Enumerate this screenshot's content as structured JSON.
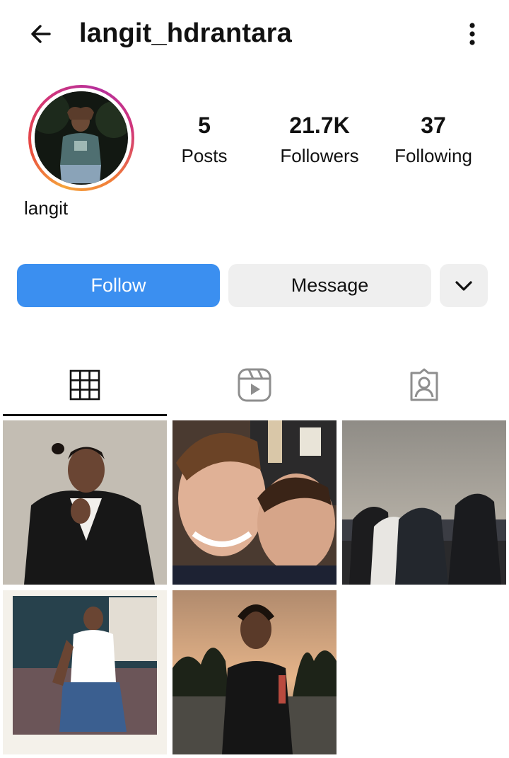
{
  "header": {
    "username": "langit_hdrantara",
    "back_icon": "arrow-left-icon",
    "more_icon": "more-vertical-icon"
  },
  "profile": {
    "display_name": "langit",
    "stats": [
      {
        "value": "5",
        "label": "Posts"
      },
      {
        "value": "21.7K",
        "label": "Followers"
      },
      {
        "value": "37",
        "label": "Following"
      }
    ]
  },
  "actions": {
    "follow_label": "Follow",
    "message_label": "Message",
    "expand_icon": "chevron-down-icon"
  },
  "tabs": [
    {
      "name": "posts",
      "icon": "grid-icon",
      "selected": true
    },
    {
      "name": "reels",
      "icon": "reels-icon",
      "selected": false
    },
    {
      "name": "tagged",
      "icon": "tagged-user-icon",
      "selected": false
    }
  ],
  "posts": [
    {
      "alt": "man in black suit portrait"
    },
    {
      "alt": "two young men selfie"
    },
    {
      "alt": "group overlooking city at dusk"
    },
    {
      "alt": "man seated polaroid photo"
    },
    {
      "alt": "man at sunset with palm trees"
    }
  ],
  "colors": {
    "accent": "#3b8ff0",
    "secondary_button": "#efefef",
    "text": "#111111",
    "icon_gray": "#8e8e8e"
  }
}
